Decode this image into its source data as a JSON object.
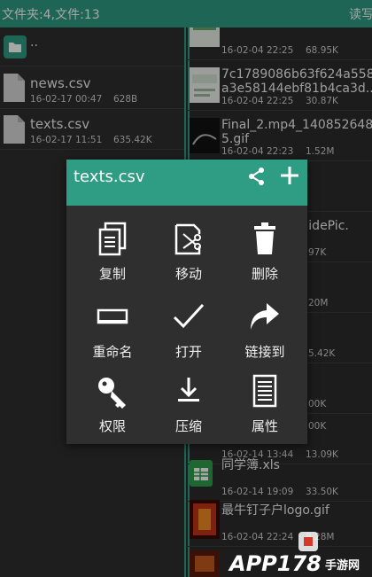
{
  "topbar": {
    "count": "文件夹:4,文件:13",
    "right_label": "读写"
  },
  "left_pane": {
    "up_label": "..",
    "files": [
      {
        "name": "news.csv",
        "date": "16-02-17 00:47",
        "size": "628B"
      },
      {
        "name": "texts.csv",
        "date": "16-02-17 11:51",
        "size": "635.42K"
      }
    ]
  },
  "right_pane": {
    "rows": [
      {
        "line1": "",
        "line2": "",
        "date": "16-02-04 22:25",
        "size": "68.95K"
      },
      {
        "line1": "7c1789086b63f624a558",
        "line2": "a3e58144ebf81b4ca3d...",
        "date": "16-02-04 22:25",
        "size": "30.87K"
      },
      {
        "line1": "Final_2.mp4_140852648",
        "line2": "5.gif",
        "date": "16-02-04 22:23",
        "size": "1.52M"
      },
      {
        "line1": "",
        "line2": "",
        "date": "",
        "size": ""
      },
      {
        "line1": "oGuidePic.",
        "line2": "",
        "date": "",
        "size": "97K"
      },
      {
        "line1": "",
        "line2": "",
        "date": "",
        "size": "20M"
      },
      {
        "line1": "",
        "line2": "",
        "date": "",
        "size": "5.42K"
      },
      {
        "line1": "",
        "line2": "",
        "date": "",
        "size": "00K"
      },
      {
        "line1": "",
        "line2": "",
        "date": "",
        "size": "00K"
      },
      {
        "line1": "",
        "line2": "",
        "date": "16-02-14 13:44",
        "size": "13.09K"
      },
      {
        "line1": "同学簿.xls",
        "line2": "",
        "date": "16-02-14 19:09",
        "size": "33.50K"
      },
      {
        "line1": "最牛钉子户logo.gif",
        "line2": "",
        "date": "16-02-04 22:24",
        "size": "8.28M"
      },
      {
        "line1": "",
        "line2": "",
        "date": "",
        "size": ""
      }
    ]
  },
  "dialog": {
    "title": "texts.csv",
    "actions": [
      {
        "label": "复制",
        "icon": "copy-icon"
      },
      {
        "label": "移动",
        "icon": "cut-icon"
      },
      {
        "label": "删除",
        "icon": "trash-icon"
      },
      {
        "label": "重命名",
        "icon": "rename-icon"
      },
      {
        "label": "打开",
        "icon": "check-icon"
      },
      {
        "label": "链接到",
        "icon": "share-arrow-icon"
      },
      {
        "label": "权限",
        "icon": "key-icon"
      },
      {
        "label": "压缩",
        "icon": "compress-icon"
      },
      {
        "label": "属性",
        "icon": "properties-icon"
      }
    ]
  },
  "watermark": {
    "text": "APP178",
    "subtext": "手游网"
  },
  "colors": {
    "accent": "#2f9c84",
    "background": "#2e2e2e"
  }
}
